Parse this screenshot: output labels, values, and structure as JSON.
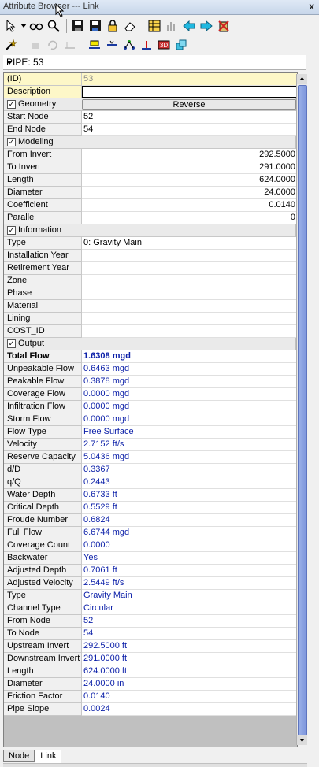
{
  "window": {
    "title": "Attribute Browser --- Link",
    "close": "x"
  },
  "selector": {
    "value": "PIPE: 53"
  },
  "grid": {
    "id_row": {
      "label": "(ID)",
      "value": "53"
    },
    "description": {
      "label": "Description",
      "value": ""
    },
    "geometry": {
      "label": "Geometry",
      "button": "Reverse"
    },
    "start_node": {
      "label": "Start Node",
      "value": "52"
    },
    "end_node": {
      "label": "End Node",
      "value": "54"
    },
    "modeling": {
      "label": "Modeling"
    },
    "from_invert": {
      "label": "From Invert",
      "value": "292.5000"
    },
    "to_invert": {
      "label": "To Invert",
      "value": "291.0000"
    },
    "length": {
      "label": "Length",
      "value": "624.0000"
    },
    "diameter": {
      "label": "Diameter",
      "value": "24.0000"
    },
    "coefficient": {
      "label": "Coefficient",
      "value": "0.0140"
    },
    "parallel": {
      "label": "Parallel",
      "value": "0"
    },
    "information": {
      "label": "Information"
    },
    "type": {
      "label": "Type",
      "value": "0: Gravity Main"
    },
    "installation_year": {
      "label": "Installation Year",
      "value": ""
    },
    "retirement_year": {
      "label": "Retirement Year",
      "value": ""
    },
    "zone": {
      "label": "Zone",
      "value": ""
    },
    "phase": {
      "label": "Phase",
      "value": ""
    },
    "material": {
      "label": "Material",
      "value": ""
    },
    "lining": {
      "label": "Lining",
      "value": ""
    },
    "cost_id": {
      "label": "COST_ID",
      "value": ""
    },
    "output": {
      "label": "Output"
    },
    "output_rows": [
      {
        "label": "Total Flow",
        "value": "1.6308 mgd"
      },
      {
        "label": "Unpeakable Flow",
        "value": "0.6463 mgd"
      },
      {
        "label": "Peakable Flow",
        "value": "0.3878 mgd"
      },
      {
        "label": "Coverage Flow",
        "value": "0.0000 mgd"
      },
      {
        "label": "Infiltration Flow",
        "value": "0.0000 mgd"
      },
      {
        "label": "Storm Flow",
        "value": "0.0000 mgd"
      },
      {
        "label": "Flow Type",
        "value": "Free Surface"
      },
      {
        "label": "Velocity",
        "value": "2.7152 ft/s"
      },
      {
        "label": "Reserve Capacity",
        "value": "5.0436 mgd"
      },
      {
        "label": "d/D",
        "value": "0.3367"
      },
      {
        "label": "q/Q",
        "value": "0.2443"
      },
      {
        "label": "Water Depth",
        "value": "0.6733 ft"
      },
      {
        "label": "Critical Depth",
        "value": "0.5529 ft"
      },
      {
        "label": "Froude Number",
        "value": "0.6824"
      },
      {
        "label": "Full Flow",
        "value": "6.6744 mgd"
      },
      {
        "label": "Coverage Count",
        "value": "0.0000"
      },
      {
        "label": "Backwater",
        "value": "Yes"
      },
      {
        "label": "Adjusted Depth",
        "value": "0.7061 ft"
      },
      {
        "label": "Adjusted Velocity",
        "value": "2.5449 ft/s"
      },
      {
        "label": "Type",
        "value": "Gravity Main"
      },
      {
        "label": "Channel Type",
        "value": "Circular"
      },
      {
        "label": "From Node",
        "value": "52"
      },
      {
        "label": "To Node",
        "value": "54"
      },
      {
        "label": "Upstream Invert",
        "value": "292.5000 ft"
      },
      {
        "label": "Downstream Invert",
        "value": "291.0000 ft"
      },
      {
        "label": "Length",
        "value": "624.0000 ft"
      },
      {
        "label": "Diameter",
        "value": "24.0000 in"
      },
      {
        "label": "Friction Factor",
        "value": "0.0140"
      },
      {
        "label": "Pipe Slope",
        "value": "0.0024"
      }
    ]
  },
  "tabs": [
    {
      "label": "Node"
    },
    {
      "label": "Link"
    }
  ],
  "colors": {
    "output_value": "#0a1ea8",
    "scroll_thumb": "#7d96dc",
    "id_highlight": "#fdf7c8"
  }
}
